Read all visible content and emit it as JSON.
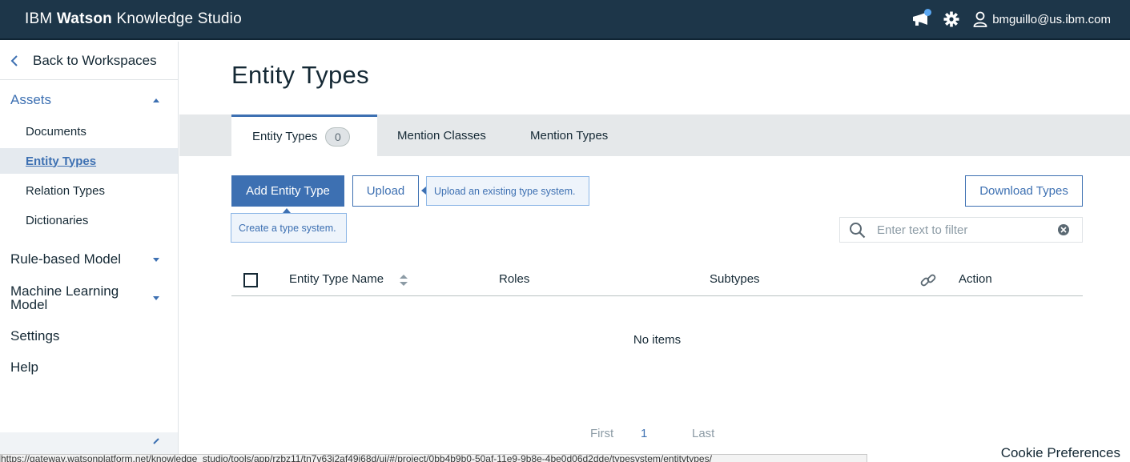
{
  "header": {
    "brand_ibm": "IBM",
    "brand_watson": "Watson",
    "brand_rest": "Knowledge Studio",
    "user": "bmguillo@us.ibm.com",
    "icons": [
      "megaphone-icon",
      "gear-icon",
      "user-icon"
    ]
  },
  "sidebar": {
    "back": "Back to Workspaces",
    "assets": "Assets",
    "asset_items": [
      "Documents",
      "Entity Types",
      "Relation Types",
      "Dictionaries"
    ],
    "rule_model": "Rule-based Model",
    "ml_model": "Machine Learning Model",
    "settings": "Settings",
    "help": "Help"
  },
  "main": {
    "title": "Entity Types",
    "tabs": [
      {
        "label": "Entity Types",
        "count": "0"
      },
      {
        "label": "Mention Classes"
      },
      {
        "label": "Mention Types"
      }
    ],
    "add_button": "Add Entity Type",
    "add_tip": "Create a type system.",
    "upload_button": "Upload",
    "upload_tip": "Upload an existing type system.",
    "download_button": "Download Types",
    "filter_placeholder": "Enter text to filter",
    "columns": [
      "Entity Type Name",
      "Roles",
      "Subtypes",
      "Action"
    ],
    "empty": "No items",
    "pager": {
      "first": "First",
      "page": "1",
      "last": "Last"
    }
  },
  "status_url": "https://gateway.watsonplatform.net/knowledge_studio/tools/app/rzbz11/tn7v63i2af49i68d/ui/#/project/0bb4b9b0-50af-11e9-9b8e-4be0d06d2dde/typesystem/entitytypes/",
  "cookie": "Cookie Preferences",
  "colors": {
    "topbar": "#1d3649",
    "accent": "#3d70b2",
    "tabbar": "#e5e8ea"
  }
}
